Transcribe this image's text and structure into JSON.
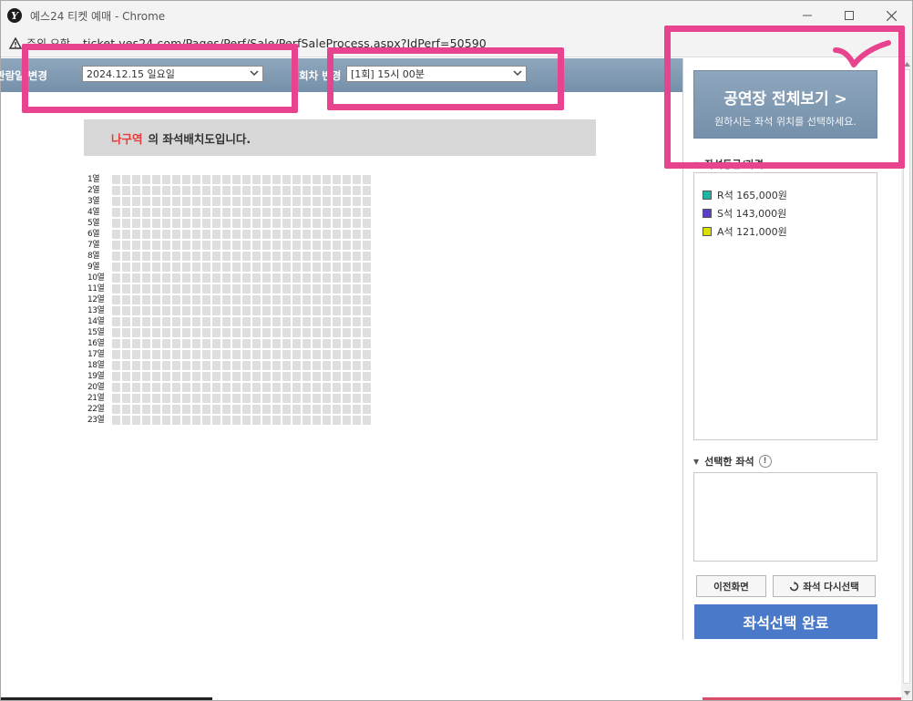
{
  "window": {
    "title": "예스24 티켓 예매 - Chrome",
    "app_icon": "Y"
  },
  "address": {
    "security_text": "주의 요함",
    "url": "ticket.yes24.com/Pages/Perf/Sale/PerfSaleProcess.aspx?IdPerf=50590"
  },
  "filters": {
    "date_label": "관람일 변경",
    "date_value": "2024.12.15 일요일",
    "session_label": "회차 변경",
    "session_value": "[1회] 15시 00분"
  },
  "venue": {
    "name": "나구역",
    "banner_suffix": "의 좌석배치도입니다."
  },
  "seatmap": {
    "rows": [
      "1열",
      "2열",
      "3열",
      "4열",
      "5열",
      "6열",
      "7열",
      "8열",
      "9열",
      "10열",
      "11열",
      "12열",
      "13열",
      "14열",
      "15열",
      "16열",
      "17열",
      "18열",
      "19열",
      "20열",
      "21열",
      "22열",
      "23열"
    ],
    "seats_per_row": 26
  },
  "panel": {
    "venue_view_title": "공연장 전체보기 >",
    "venue_view_sub": "원하시는 좌석 위치를 선택하세요.",
    "grade_section": "좌석등급/가격",
    "grades": [
      {
        "label": "R석 165,000원",
        "color": "#1fb5a6"
      },
      {
        "label": "S석 143,000원",
        "color": "#5a3ec8"
      },
      {
        "label": "A석 121,000원",
        "color": "#d8e000"
      }
    ],
    "selected_section": "선택한 좌석",
    "info_glyph": "!",
    "prev_button": "이전화면",
    "reselect_button": "좌석 다시선택",
    "complete_button": "좌석선택 완료"
  },
  "colors": {
    "header_blue": "#7f98b1",
    "complete_blue": "#4a79c9",
    "annotation_pink": "#e8438f",
    "venue_red": "#e23c3c"
  }
}
